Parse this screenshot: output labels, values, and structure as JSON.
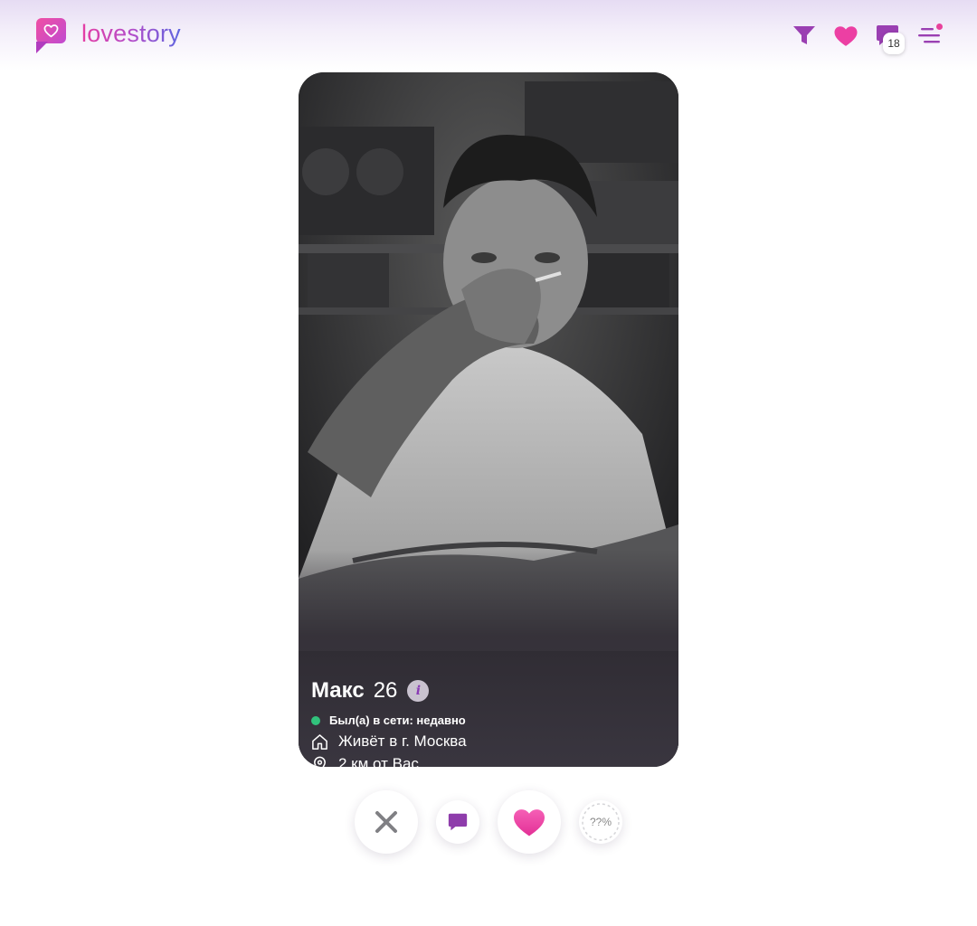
{
  "brand": {
    "name": "lovestory",
    "accent": "#b44cc9",
    "pink": "#e8419b"
  },
  "header": {
    "filter_icon": "filter-icon",
    "likes_icon": "heart-icon",
    "messages_icon": "chat-icon",
    "messages_badge": "18",
    "menu_icon": "menu-icon"
  },
  "profile": {
    "name": "Макс",
    "age": "26",
    "info_label": "i",
    "status": "Был(а) в сети: недавно",
    "status_color": "#31c27c",
    "city": "Живёт в г. Москва",
    "distance": "2 км от Вас"
  },
  "actions": {
    "dislike_icon": "close-icon",
    "message_icon": "chat-icon",
    "like_icon": "heart-icon",
    "compatibility": "??%"
  }
}
